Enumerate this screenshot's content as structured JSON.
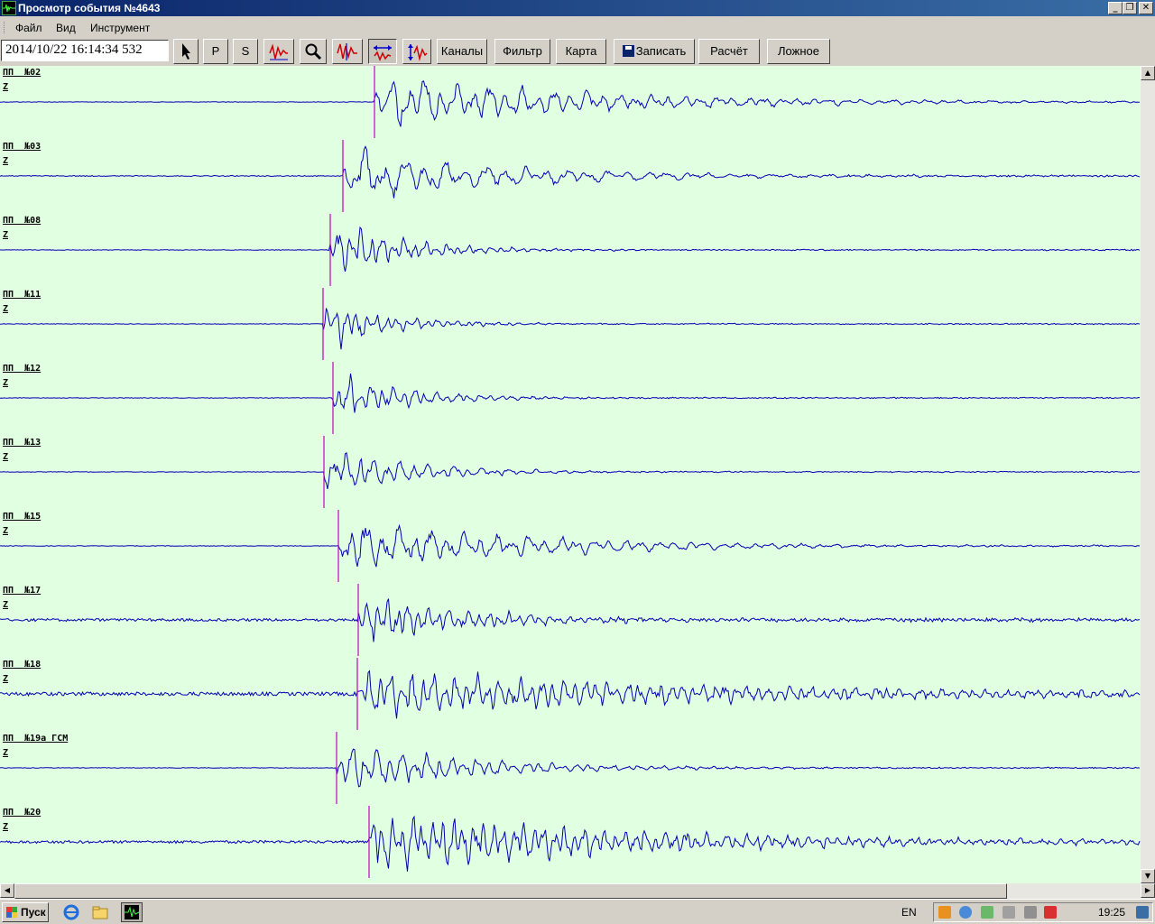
{
  "window": {
    "title": "Просмотр события №4643",
    "minimize": "_",
    "maximize": "❐",
    "close": "✕"
  },
  "menu": {
    "items": [
      "Файл",
      "Вид",
      "Инструмент"
    ]
  },
  "toolbar": {
    "datetime": "2014/10/22 16:14:34 532",
    "p_label": "P",
    "s_label": "S",
    "channels_label": "Каналы",
    "filter_label": "Фильтр",
    "map_label": "Карта",
    "save_label": "Записать",
    "calc_label": "Расчёт",
    "false_label": "Ложное",
    "icons": {
      "pointer": "pointer-icon",
      "filter_fa": "filter-fa-icon",
      "zoom": "magnifier-icon",
      "gain": "gain-icon",
      "fit_horizontal": "fit-horizontal-icon",
      "fit_vertical": "fit-vertical-icon"
    }
  },
  "traces": {
    "background": "#e1ffe1",
    "trace_color": "#0000b4",
    "pick_color": "#c000c0",
    "channels": [
      {
        "name": "ПП  №02",
        "component": "Z",
        "pick": 415,
        "amp": 32,
        "noise": 0.3,
        "decay": 220,
        "freq": 1.0
      },
      {
        "name": "ПП  №03",
        "component": "Z",
        "pick": 380,
        "amp": 30,
        "noise": 0.5,
        "decay": 180,
        "freq": 0.8
      },
      {
        "name": "ПП  №08",
        "component": "Z",
        "pick": 366,
        "amp": 32,
        "noise": 0.3,
        "decay": 80,
        "freq": 1.5
      },
      {
        "name": "ПП  №11",
        "component": "Z",
        "pick": 358,
        "amp": 30,
        "noise": 0.3,
        "decay": 70,
        "freq": 1.6
      },
      {
        "name": "ПП  №12",
        "component": "Z",
        "pick": 369,
        "amp": 28,
        "noise": 0.3,
        "decay": 80,
        "freq": 1.5
      },
      {
        "name": "ПП  №13",
        "component": "Z",
        "pick": 359,
        "amp": 30,
        "noise": 0.3,
        "decay": 90,
        "freq": 1.2
      },
      {
        "name": "ПП  №15",
        "component": "Z",
        "pick": 375,
        "amp": 30,
        "noise": 0.3,
        "decay": 200,
        "freq": 1.0
      },
      {
        "name": "ПП  №17",
        "component": "Z",
        "pick": 397,
        "amp": 28,
        "noise": 1.5,
        "decay": 120,
        "freq": 1.6
      },
      {
        "name": "ПП  №18",
        "component": "Z",
        "pick": 396,
        "amp": 26,
        "noise": 2.0,
        "decay": 400,
        "freq": 1.5
      },
      {
        "name": "ПП  №19а ГСМ",
        "component": "Z",
        "pick": 373,
        "amp": 30,
        "noise": 0.3,
        "decay": 140,
        "freq": 1.3
      },
      {
        "name": "ПП  №20",
        "component": "Z",
        "pick": 409,
        "amp": 34,
        "noise": 1.5,
        "decay": 300,
        "freq": 1.6
      }
    ]
  },
  "taskbar": {
    "start_label": "Пуск",
    "language": "EN",
    "clock": "19:25"
  }
}
